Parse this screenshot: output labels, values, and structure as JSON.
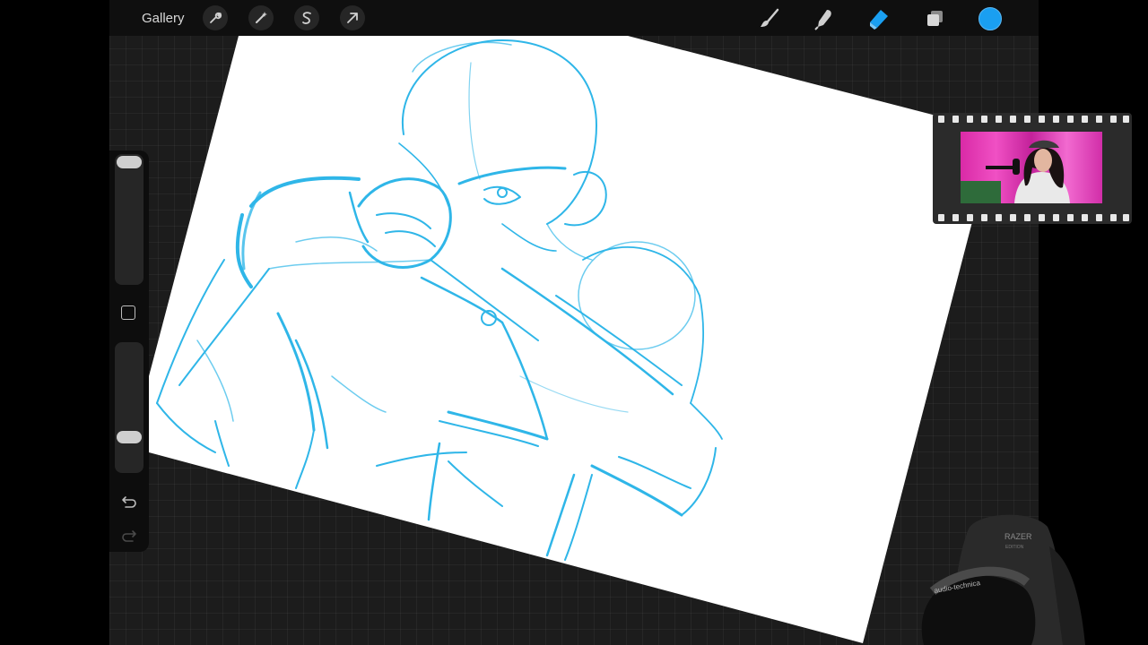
{
  "toolbar": {
    "gallery_label": "Gallery",
    "left_tools": [
      {
        "name": "wrench-icon",
        "label": "Actions"
      },
      {
        "name": "magic-wand-icon",
        "label": "Adjustments"
      },
      {
        "name": "selection-icon",
        "label": "Selection"
      },
      {
        "name": "transform-arrow-icon",
        "label": "Transform"
      }
    ],
    "right_tools": [
      {
        "name": "brush-icon",
        "label": "Paint"
      },
      {
        "name": "smudge-icon",
        "label": "Smudge"
      },
      {
        "name": "eraser-icon",
        "label": "Erase",
        "active": true
      },
      {
        "name": "layers-icon",
        "label": "Layers"
      }
    ],
    "current_color": "#1a9ff1"
  },
  "sidebar": {
    "brush_size_level": 0.0,
    "opacity_level": 1.0,
    "icons": [
      "square-modify-icon",
      "undo-icon",
      "redo-icon"
    ]
  },
  "canvas": {
    "paper_color": "#ffffff",
    "sketch_color": "#2fb6e8",
    "subject": "blue pencil sketch of a figure"
  },
  "overlays": {
    "webcam_frame": "film-strip-icon",
    "chair_brand_text": "RAZER",
    "chair_sub_text": "EDITION",
    "headphones_text": "audio-technica"
  },
  "colors": {
    "accent_blue": "#1a9ff1",
    "app_bg": "#1c1c1c",
    "toolbar_bg": "#0f0f0f"
  }
}
